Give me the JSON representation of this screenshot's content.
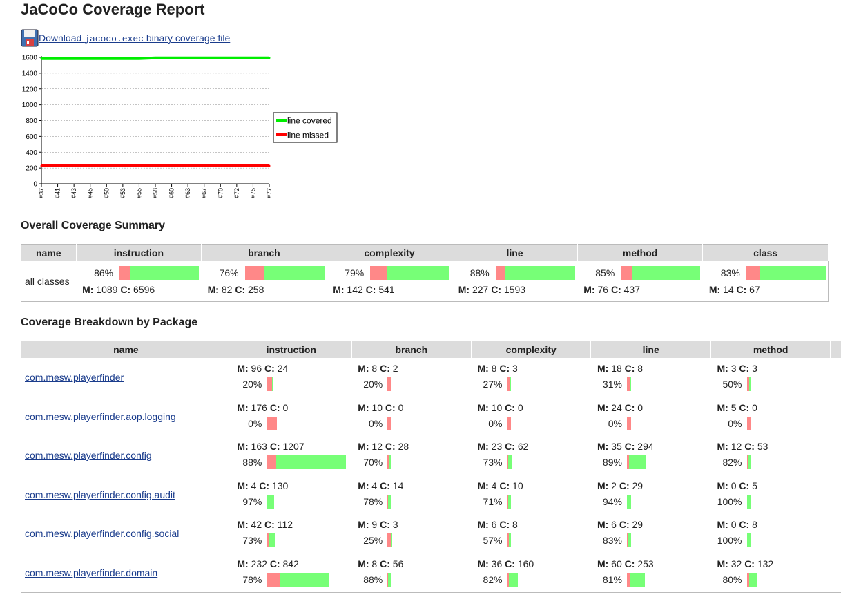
{
  "title": "JaCoCo Coverage Report",
  "download": {
    "prefix": "Download ",
    "code": "jacoco.exec",
    "suffix": " binary coverage file"
  },
  "chart_data": {
    "type": "line",
    "categories": [
      "#37",
      "#41",
      "#43",
      "#45",
      "#50",
      "#53",
      "#55",
      "#58",
      "#60",
      "#63",
      "#67",
      "#70",
      "#72",
      "#75",
      "#77"
    ],
    "series": [
      {
        "name": "line covered",
        "color": "#00ee00",
        "values": [
          1585,
          1585,
          1585,
          1585,
          1585,
          1585,
          1585,
          1593,
          1593,
          1593,
          1593,
          1593,
          1593,
          1593,
          1593
        ]
      },
      {
        "name": "line missed",
        "color": "#ff0000",
        "values": [
          227,
          227,
          227,
          227,
          227,
          227,
          227,
          227,
          227,
          227,
          227,
          227,
          227,
          227,
          227
        ]
      }
    ],
    "yticks": [
      "1600",
      "1400",
      "1200",
      "1000",
      "800",
      "600",
      "400",
      "200",
      "0"
    ],
    "ylim": [
      0,
      1600
    ],
    "grid": true,
    "legend": "right"
  },
  "summary": {
    "heading": "Overall Coverage Summary",
    "headers": [
      "name",
      "instruction",
      "branch",
      "complexity",
      "line",
      "method",
      "class"
    ],
    "row_name": "all classes",
    "cols": [
      {
        "pct": "86%",
        "m": "1089",
        "c": "6596",
        "frac": 0.86
      },
      {
        "pct": "76%",
        "m": "82",
        "c": "258",
        "frac": 0.76
      },
      {
        "pct": "79%",
        "m": "142",
        "c": "541",
        "frac": 0.79
      },
      {
        "pct": "88%",
        "m": "227",
        "c": "1593",
        "frac": 0.88
      },
      {
        "pct": "85%",
        "m": "76",
        "c": "437",
        "frac": 0.85
      },
      {
        "pct": "83%",
        "m": "14",
        "c": "67",
        "frac": 0.83
      }
    ]
  },
  "packages": {
    "heading": "Coverage Breakdown by Package",
    "headers": [
      "name",
      "instruction",
      "branch",
      "complexity",
      "line",
      "method"
    ],
    "m_label": "M:",
    "c_label": "C:",
    "rows": [
      {
        "name": "com.mesw.playerfinder",
        "cols": [
          {
            "m": "96",
            "c": "24",
            "pct": "20%"
          },
          {
            "m": "8",
            "c": "2",
            "pct": "20%"
          },
          {
            "m": "8",
            "c": "3",
            "pct": "27%"
          },
          {
            "m": "18",
            "c": "8",
            "pct": "31%"
          },
          {
            "m": "3",
            "c": "3",
            "pct": "50%"
          }
        ]
      },
      {
        "name": "com.mesw.playerfinder.aop.logging",
        "cols": [
          {
            "m": "176",
            "c": "0",
            "pct": "0%"
          },
          {
            "m": "10",
            "c": "0",
            "pct": "0%"
          },
          {
            "m": "10",
            "c": "0",
            "pct": "0%"
          },
          {
            "m": "24",
            "c": "0",
            "pct": "0%"
          },
          {
            "m": "5",
            "c": "0",
            "pct": "0%"
          }
        ]
      },
      {
        "name": "com.mesw.playerfinder.config",
        "cols": [
          {
            "m": "163",
            "c": "1207",
            "pct": "88%"
          },
          {
            "m": "12",
            "c": "28",
            "pct": "70%"
          },
          {
            "m": "23",
            "c": "62",
            "pct": "73%"
          },
          {
            "m": "35",
            "c": "294",
            "pct": "89%"
          },
          {
            "m": "12",
            "c": "53",
            "pct": "82%"
          }
        ]
      },
      {
        "name": "com.mesw.playerfinder.config.audit",
        "cols": [
          {
            "m": "4",
            "c": "130",
            "pct": "97%"
          },
          {
            "m": "4",
            "c": "14",
            "pct": "78%"
          },
          {
            "m": "4",
            "c": "10",
            "pct": "71%"
          },
          {
            "m": "2",
            "c": "29",
            "pct": "94%"
          },
          {
            "m": "0",
            "c": "5",
            "pct": "100%"
          }
        ]
      },
      {
        "name": "com.mesw.playerfinder.config.social",
        "cols": [
          {
            "m": "42",
            "c": "112",
            "pct": "73%"
          },
          {
            "m": "9",
            "c": "3",
            "pct": "25%"
          },
          {
            "m": "6",
            "c": "8",
            "pct": "57%"
          },
          {
            "m": "6",
            "c": "29",
            "pct": "83%"
          },
          {
            "m": "0",
            "c": "8",
            "pct": "100%"
          }
        ]
      },
      {
        "name": "com.mesw.playerfinder.domain",
        "cols": [
          {
            "m": "232",
            "c": "842",
            "pct": "78%"
          },
          {
            "m": "8",
            "c": "56",
            "pct": "88%"
          },
          {
            "m": "36",
            "c": "160",
            "pct": "82%"
          },
          {
            "m": "60",
            "c": "253",
            "pct": "81%"
          },
          {
            "m": "32",
            "c": "132",
            "pct": "80%"
          }
        ]
      }
    ]
  }
}
